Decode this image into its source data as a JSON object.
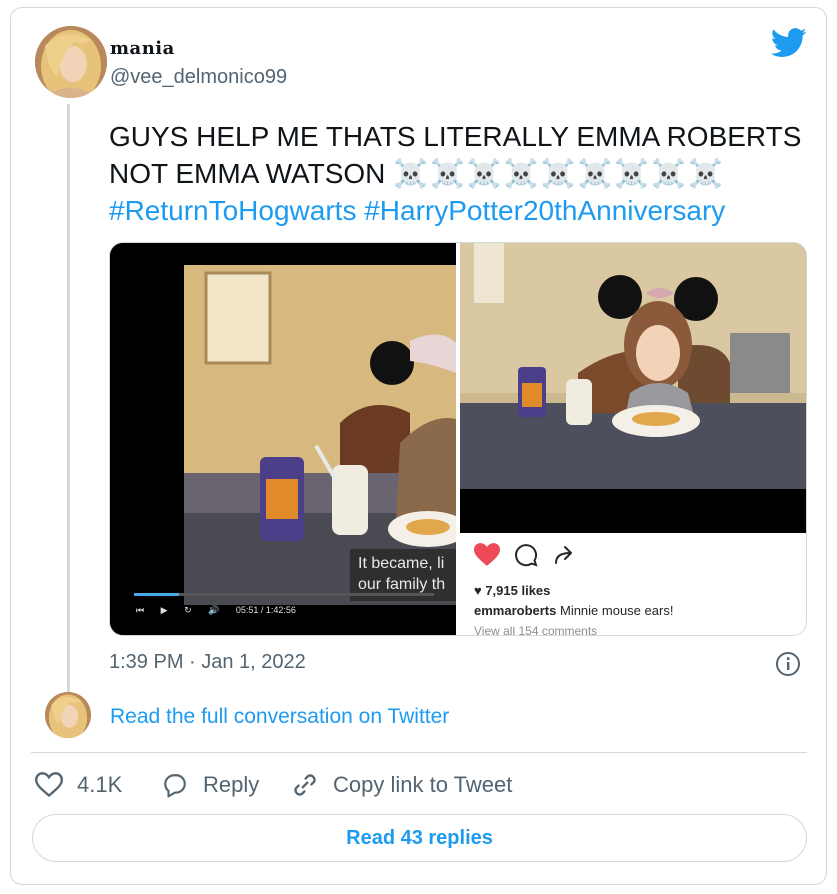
{
  "author": {
    "display_name": "mania",
    "handle": "@vee_delmonico99"
  },
  "tweet": {
    "line1": "GUYS HELP ME THATS LITERALLY EMMA ROBERTS",
    "line2_text": "NOT EMMA WATSON ",
    "line2_emoji": "☠️☠️☠️☠️☠️☠️☠️☠️☠️",
    "hashtags": "#ReturnToHogwarts #HarryPotter20thAnniversary"
  },
  "media": {
    "video": {
      "caption_line1": "It became, li",
      "caption_line2": "our family th",
      "time": "05:51 / 1:42:56",
      "progress": 0.15
    },
    "instagram": {
      "likes": "♥ 7,915 likes",
      "username": "emmaroberts",
      "caption": " Minnie mouse ears!",
      "more": "View all 154 comments"
    }
  },
  "timestamp": "1:39 PM · Jan 1, 2022",
  "read_conversation": "Read the full conversation on Twitter",
  "actions": {
    "likes": "4.1K",
    "reply": "Reply",
    "copy_link": "Copy link to Tweet"
  },
  "read_replies": "Read 43 replies",
  "colors": {
    "accent": "#1d9bf0",
    "secondary_text": "#536471",
    "border": "#cfd9de",
    "heart": "#ed4956"
  },
  "icons": [
    "twitter-bird-icon",
    "info-icon",
    "heart-icon",
    "reply-icon",
    "link-icon"
  ]
}
